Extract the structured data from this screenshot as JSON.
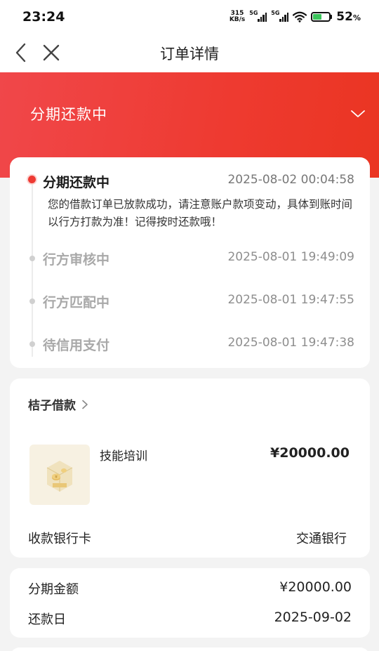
{
  "status_bar": {
    "time": "23:24",
    "net_speed_value": "315",
    "net_speed_unit": "KB/s",
    "sim1": "5G",
    "sim2": "5G",
    "battery_percent": "52",
    "battery_unit": "%",
    "battery_level": 0.52
  },
  "nav": {
    "title": "订单详情",
    "back_icon": "chevron-left-icon",
    "close_icon": "close-icon"
  },
  "header": {
    "status": "分期还款中",
    "chevron_icon": "chevron-down-icon",
    "color": "#ee3a30"
  },
  "timeline": {
    "items": [
      {
        "title": "分期还款中",
        "time": "2025-08-02 00:04:58",
        "desc": "您的借款订单已放款成功，请注意账户款项变动，具体到账时间以行方打款为准！记得按时还款哦！"
      },
      {
        "title": "行方审核中",
        "time": "2025-08-01 19:49:09"
      },
      {
        "title": "行方匹配中",
        "time": "2025-08-01 19:47:55"
      },
      {
        "title": "待信用支付",
        "time": "2025-08-01 19:47:38"
      }
    ]
  },
  "loan": {
    "merchant": "桔子借款",
    "product_name": "技能培训",
    "product_price": "¥20000.00",
    "bank_label": "收款银行卡",
    "bank_value": "交通银行"
  },
  "amounts": {
    "installment_label": "分期金额",
    "installment_value": "¥20000.00",
    "repay_day_label": "还款日",
    "repay_day_value": "2025-09-02"
  }
}
